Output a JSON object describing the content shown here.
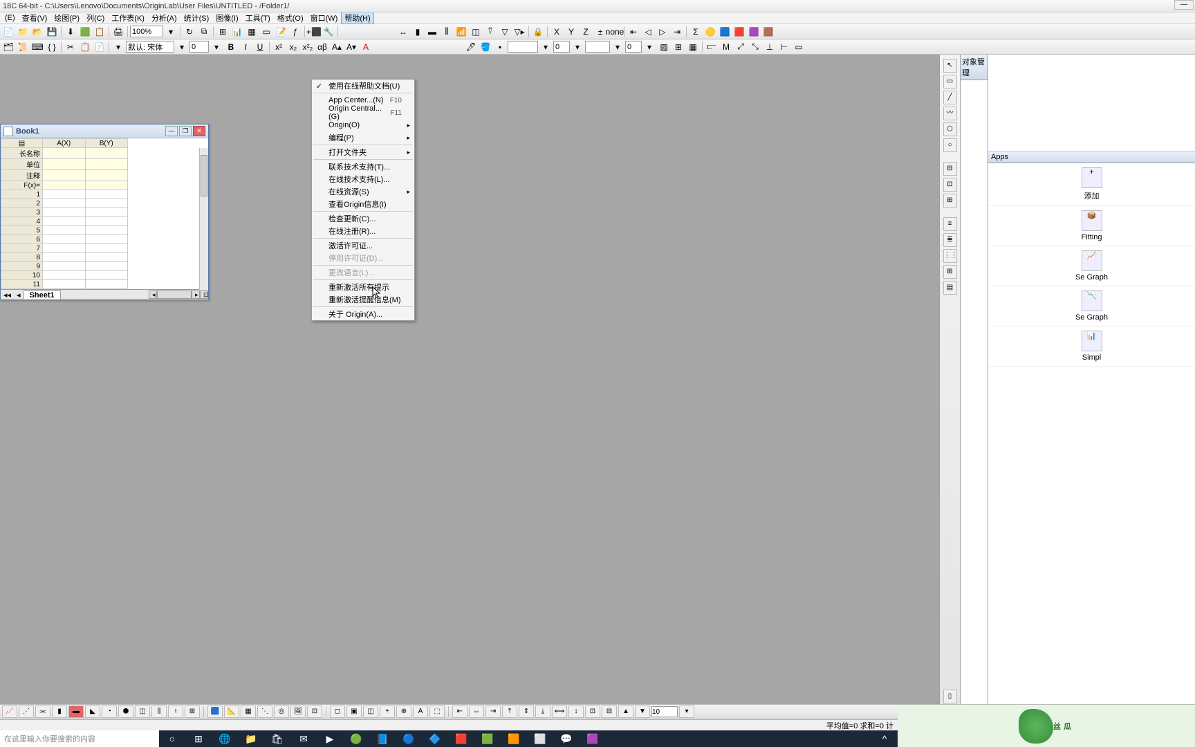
{
  "title": "18C 64-bit - C:\\Users\\Lenovo\\Documents\\OriginLab\\User Files\\UNTITLED - /Folder1/",
  "menubar": [
    "(E)",
    "查看(V)",
    "绘图(P)",
    "列(C)",
    "工作表(K)",
    "分析(A)",
    "统计(S)",
    "图像(I)",
    "工具(T)",
    "格式(O)",
    "窗口(W)",
    "帮助(H)"
  ],
  "toolbar2": {
    "font": "默认: 宋体",
    "size1": "0",
    "size2": "0",
    "size3": "0"
  },
  "zoom": "100%",
  "book": {
    "title": "Book1",
    "cols": [
      "A(X)",
      "B(Y)"
    ],
    "rowlabels": [
      "长名称",
      "单位",
      "注释",
      "F(x)="
    ],
    "rows": [
      "1",
      "2",
      "3",
      "4",
      "5",
      "6",
      "7",
      "8",
      "9",
      "10",
      "11"
    ],
    "sheet": "Sheet1"
  },
  "helpmenu": [
    {
      "label": "使用在线帮助文档(U)",
      "checked": true
    },
    {
      "sep": true
    },
    {
      "label": "App Center...(N)",
      "shortcut": "F10"
    },
    {
      "label": "Origin Central...(G)",
      "shortcut": "F11"
    },
    {
      "label": "Origin(O)",
      "sub": true
    },
    {
      "label": "编程(P)",
      "sub": true
    },
    {
      "sep": true
    },
    {
      "label": "打开文件夹",
      "sub": true
    },
    {
      "sep": true
    },
    {
      "label": "联系技术支持(T)..."
    },
    {
      "label": "在线技术支持(L)..."
    },
    {
      "label": "在线资源(S)",
      "sub": true
    },
    {
      "label": "查看Origin信息(I)"
    },
    {
      "sep": true
    },
    {
      "label": "检查更新(C)..."
    },
    {
      "label": "在线注册(R)..."
    },
    {
      "sep": true
    },
    {
      "label": "激活许可证..."
    },
    {
      "label": "停用许可证(D)...",
      "disabled": true
    },
    {
      "sep": true
    },
    {
      "label": "更改语言(L)...",
      "disabled": true
    },
    {
      "sep": true
    },
    {
      "label": "重新激活所有提示"
    },
    {
      "label": "重新激活提醒信息(M)"
    },
    {
      "sep": true
    },
    {
      "label": "关于 Origin(A)..."
    }
  ],
  "objpanel": "对象管理",
  "appspanel": {
    "title": "Apps",
    "items": [
      "添加",
      "Se Graph",
      "Se Graph",
      "Simpl",
      "Fitting"
    ]
  },
  "statusbar": "平均值=0 求和=0 计",
  "bottombar_size": "10",
  "taskbar": {
    "search_placeholder": "在这里输入你要搜索的内容"
  },
  "watermark": "丝瓜"
}
